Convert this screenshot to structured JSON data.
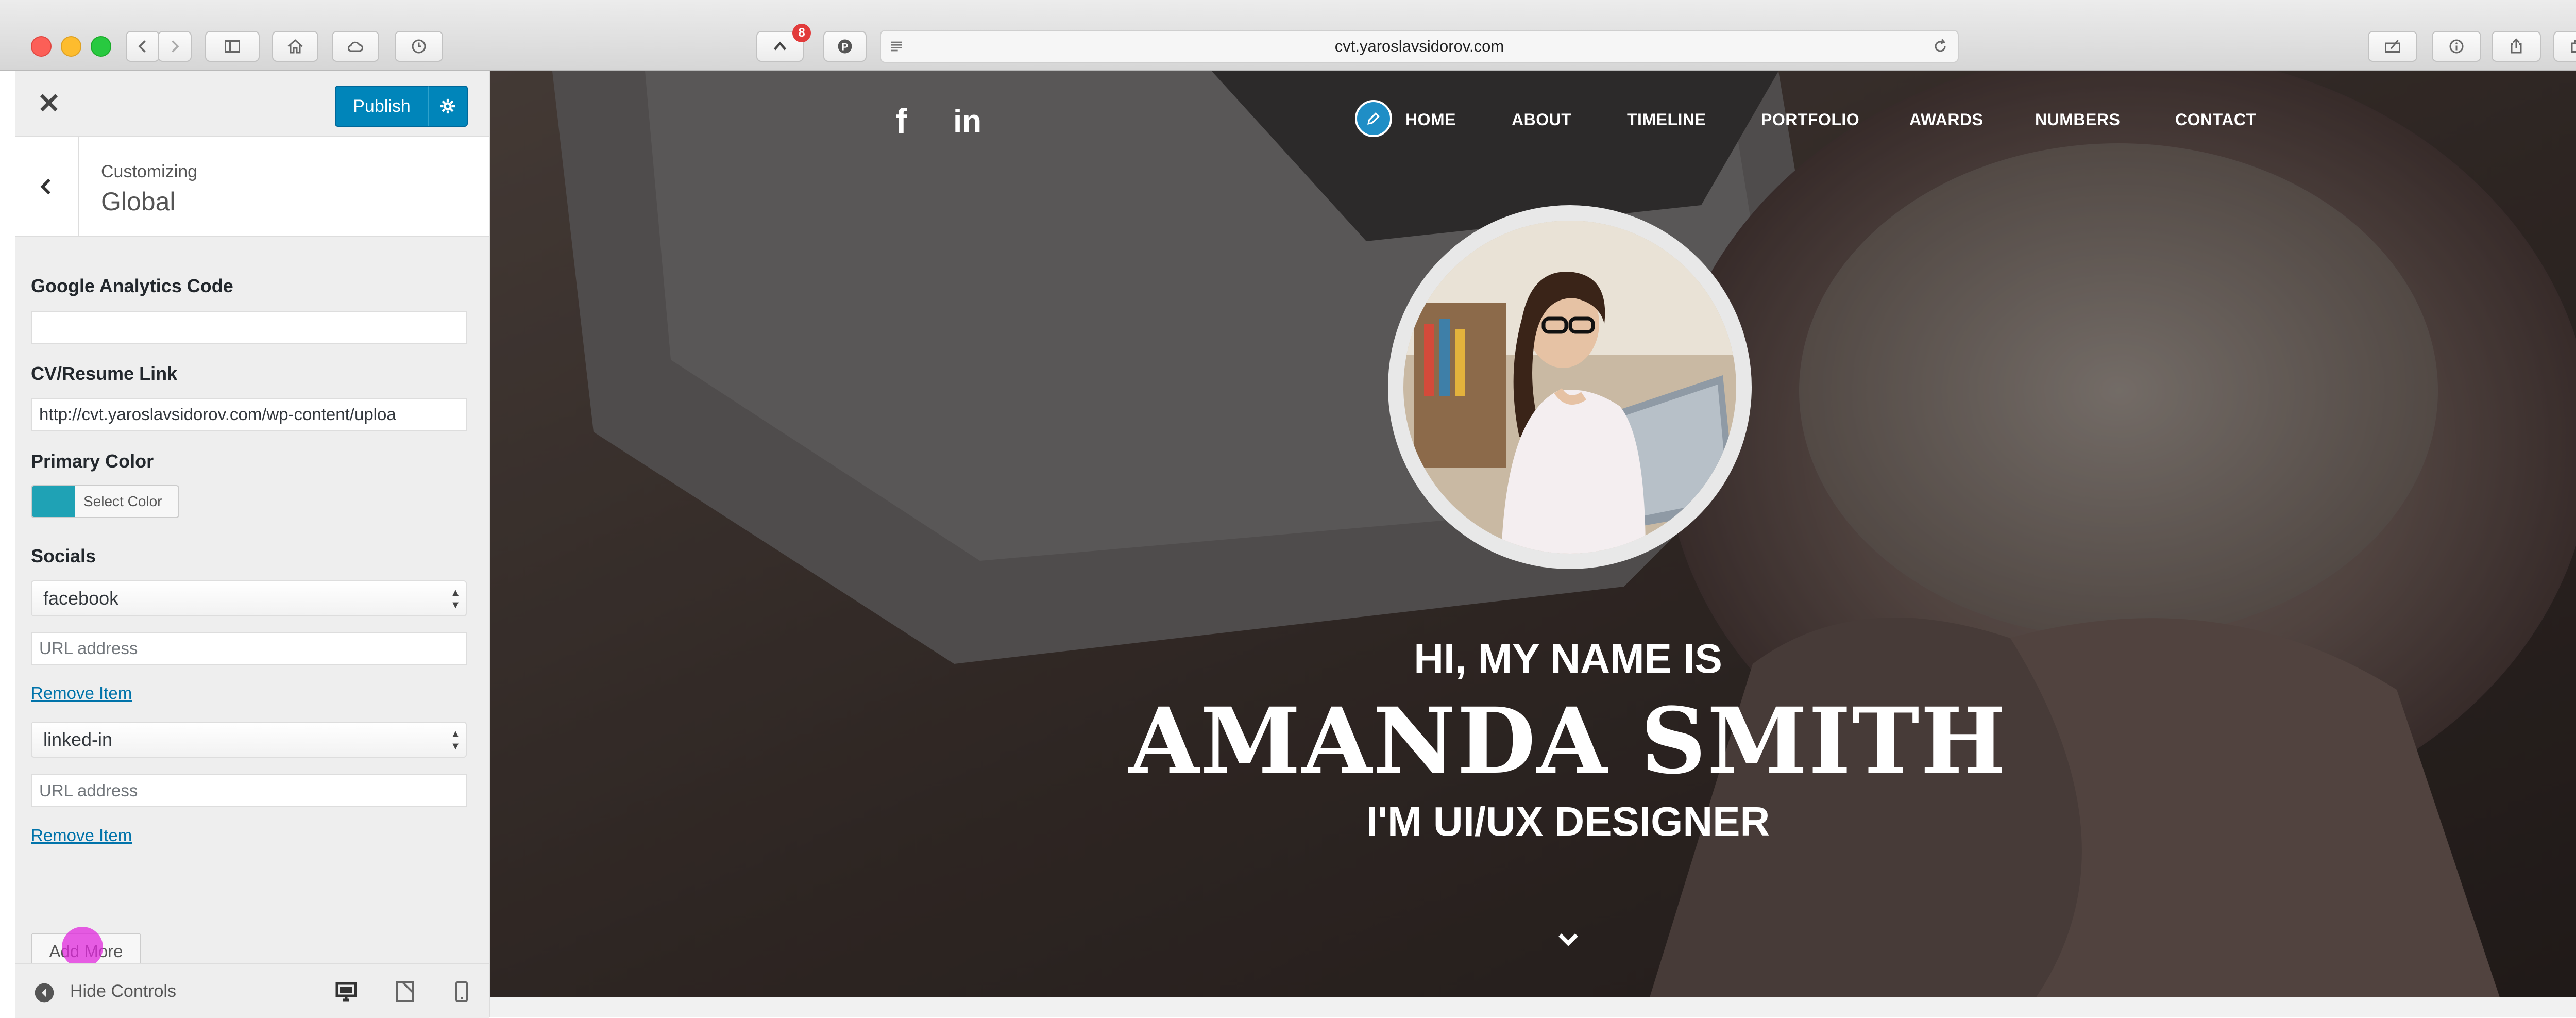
{
  "browser": {
    "url": "cvt.yaroslavsidorov.com",
    "extension_badge": "8"
  },
  "customizer": {
    "publish_label": "Publish",
    "crumb_small": "Customizing",
    "crumb_title": "Global",
    "fields": {
      "analytics_label": "Google Analytics Code",
      "analytics_value": "",
      "cv_label": "CV/Resume Link",
      "cv_value": "http://cvt.yaroslavsidorov.com/wp-content/uploa",
      "primary_color_label": "Primary Color",
      "primary_color_value": "#1fa2b5",
      "select_color_label": "Select Color",
      "socials_label": "Socials"
    },
    "socials": [
      {
        "network": "facebook",
        "url_placeholder": "URL address",
        "remove_label": "Remove Item"
      },
      {
        "network": "linked-in",
        "url_placeholder": "URL address",
        "remove_label": "Remove Item"
      }
    ],
    "add_more_label": "Add More",
    "hide_controls_label": "Hide Controls"
  },
  "site": {
    "nav": [
      "HOME",
      "ABOUT",
      "TIMELINE",
      "PORTFOLIO",
      "AWARDS",
      "NUMBERS",
      "CONTACT"
    ],
    "social_icons": [
      "facebook-icon",
      "linkedin-icon"
    ],
    "hero": {
      "line1": "HI, MY NAME IS",
      "name": "AMANDA SMITH",
      "line3": "I'M UI/UX DESIGNER"
    }
  },
  "colors": {
    "publish": "#0085ba",
    "primary": "#1fa2b5",
    "link": "#0073aa"
  }
}
